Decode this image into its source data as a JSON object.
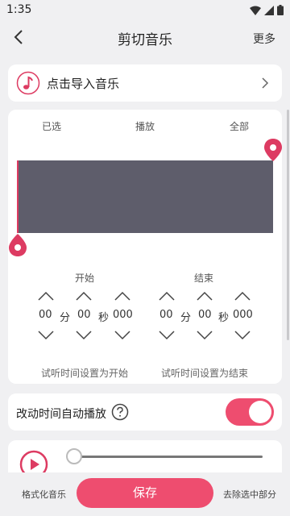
{
  "status": {
    "time": "1:35"
  },
  "header": {
    "title": "剪切音乐",
    "more_label": "更多"
  },
  "import": {
    "label": "点击导入音乐"
  },
  "wave": {
    "tabs": [
      "已选",
      "播放",
      "全部"
    ],
    "accent": "#dd3b62",
    "start": {
      "label": "开始",
      "min": "00",
      "min_unit": "分",
      "sec": "00",
      "sec_unit": "秒",
      "ms": "000"
    },
    "end": {
      "label": "结束",
      "min": "00",
      "min_unit": "分",
      "sec": "00",
      "sec_unit": "秒",
      "ms": "000"
    },
    "audition_start": "试听时间设置为开始",
    "audition_end": "试听时间设置为结束"
  },
  "auto_play": {
    "label": "改动时间自动播放",
    "enabled": true
  },
  "player": {
    "progress": 0
  },
  "footer": {
    "format_label": "格式化音乐",
    "save_label": "保存",
    "remove_label": "去除选中部分",
    "accent": "#ee4d6f"
  }
}
